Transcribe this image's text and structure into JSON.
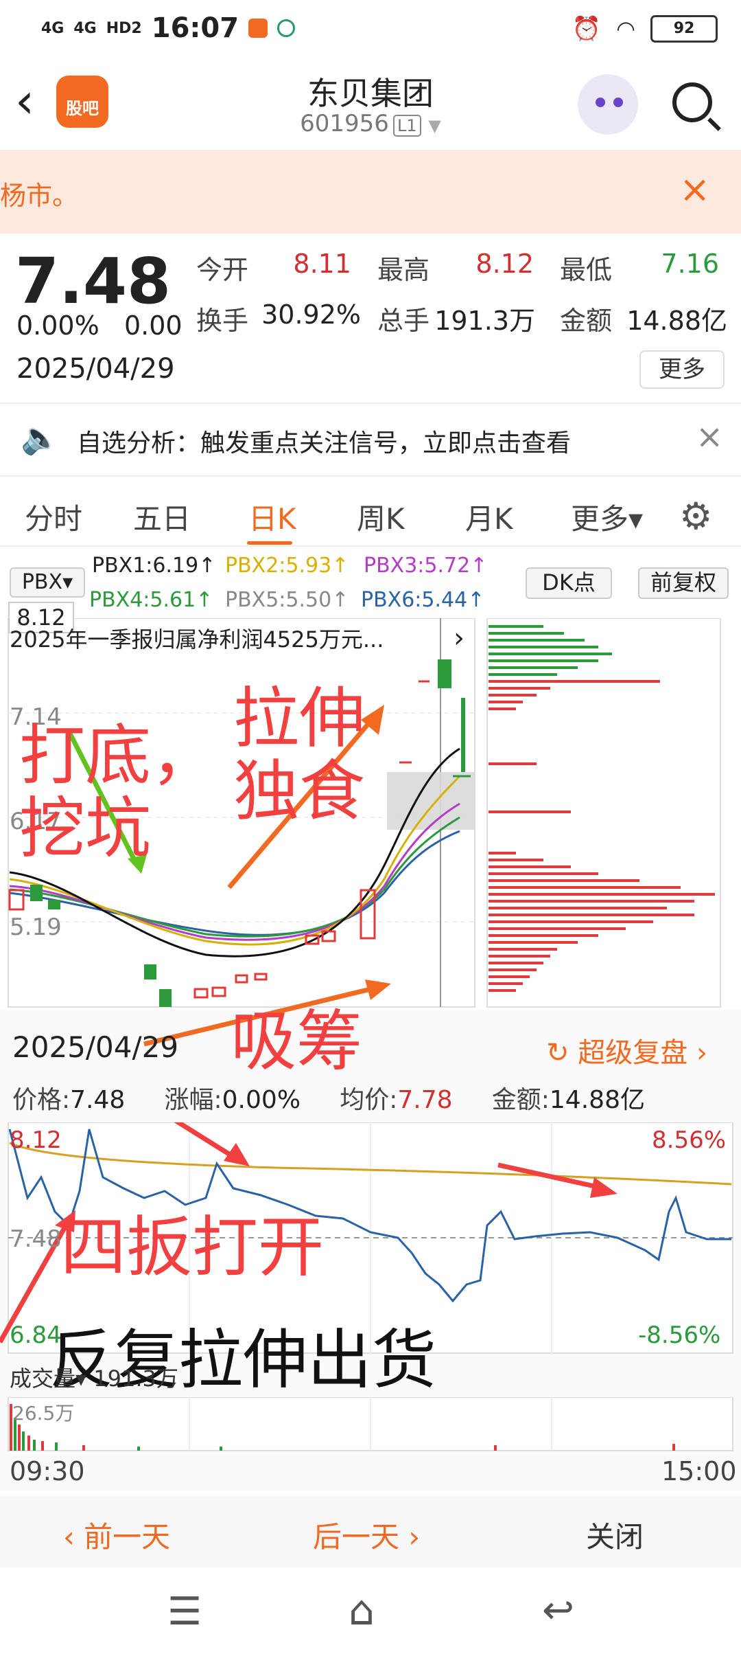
{
  "status_bar": {
    "network1": "4G",
    "network2": "4G",
    "hd": "HD2",
    "time": "16:07",
    "battery": "92"
  },
  "header": {
    "app_badge": "股吧",
    "stock_name": "东贝集团",
    "stock_code": "601956",
    "level": "L1"
  },
  "notice": {
    "text": "杨市。",
    "close": "×"
  },
  "quote": {
    "price": "7.48",
    "change_pct": "0.00%",
    "change": "0.00",
    "date": "2025/04/29",
    "open_label": "今开",
    "open": "8.11",
    "high_label": "最高",
    "high": "8.12",
    "low_label": "最低",
    "low": "7.16",
    "turnover_label": "换手",
    "turnover": "30.92%",
    "volume_label": "总手",
    "volume": "191.3万",
    "amount_label": "金额",
    "amount": "14.88亿",
    "more": "更多"
  },
  "alert": {
    "text": "自选分析：触发重点关注信号，立即点击查看",
    "close": "×"
  },
  "tabs": [
    "分时",
    "五日",
    "日K",
    "周K",
    "月K",
    "更多▾"
  ],
  "indicators": {
    "selector": "PBX▾",
    "pbx1": "PBX1:6.19↑",
    "pbx2": "PBX2:5.93↑",
    "pbx3": "PBX3:5.72↑",
    "pbx4": "PBX4:5.61↑",
    "pbx5": "PBX5:5.50↑",
    "pbx6": "PBX6:5.44↑",
    "dk": "DK点",
    "adjust": "前复权",
    "high_label": "8.12",
    "news": "2025年一季报归属净利润4525万元...",
    "y1": "7.14",
    "y2": "6.17",
    "y3": "5.19"
  },
  "annotations": {
    "bottom_dig": "打底，\n挖坑",
    "stretch": "拉伸\n独食",
    "accumulate": "吸筹",
    "four_sweep": "四扳打开",
    "repeat": "反复拉伸出货"
  },
  "intraday": {
    "date": "2025/04/29",
    "replay": "超级复盘 ›",
    "price_label": "价格:",
    "price": "7.48",
    "chg_label": "涨幅:",
    "chg": "0.00%",
    "avg_label": "均价:",
    "avg": "7.78",
    "amt_label": "金额:",
    "amt": "14.88亿",
    "top_left": "8.12",
    "top_right": "8.56%",
    "mid_left": "7.48",
    "bottom_left": "6.84",
    "bottom_right": "-8.56%",
    "vol_selector": "成交量▾",
    "vol_total": "191.3万",
    "vol_max": "26.5万",
    "time_start": "09:30",
    "time_end": "15:00"
  },
  "bottom_bar": {
    "prev": "‹ 前一天",
    "next": "后一天 ›",
    "close": "关闭"
  },
  "colors": {
    "accent": "#f26a21",
    "up": "#e03a3a",
    "down": "#2a9a3a"
  }
}
